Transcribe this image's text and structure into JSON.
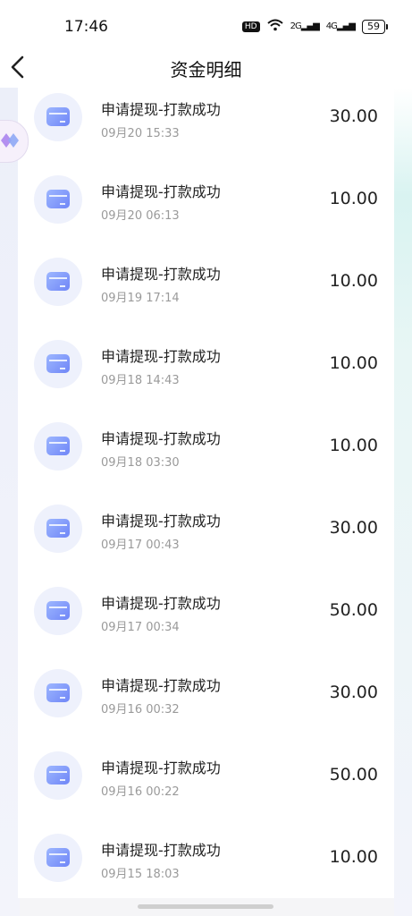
{
  "status_bar": {
    "time": "17:46",
    "hd": "HD",
    "net1": "2G",
    "net2": "4G",
    "battery": "59"
  },
  "header": {
    "title": "资金明细"
  },
  "records": [
    {
      "title": "申请提现-打款成功",
      "time": "09月20 15:33",
      "amount": "30.00"
    },
    {
      "title": "申请提现-打款成功",
      "time": "09月20 06:13",
      "amount": "10.00"
    },
    {
      "title": "申请提现-打款成功",
      "time": "09月19 17:14",
      "amount": "10.00"
    },
    {
      "title": "申请提现-打款成功",
      "time": "09月18 14:43",
      "amount": "10.00"
    },
    {
      "title": "申请提现-打款成功",
      "time": "09月18 03:30",
      "amount": "10.00"
    },
    {
      "title": "申请提现-打款成功",
      "time": "09月17 00:43",
      "amount": "30.00"
    },
    {
      "title": "申请提现-打款成功",
      "time": "09月17 00:34",
      "amount": "50.00"
    },
    {
      "title": "申请提现-打款成功",
      "time": "09月16 00:32",
      "amount": "30.00"
    },
    {
      "title": "申请提现-打款成功",
      "time": "09月16 00:22",
      "amount": "50.00"
    },
    {
      "title": "申请提现-打款成功",
      "time": "09月15 18:03",
      "amount": "10.00"
    }
  ],
  "icons": {
    "back": "chevron-left-icon",
    "record": "card-icon",
    "side": "diamond-icon"
  }
}
